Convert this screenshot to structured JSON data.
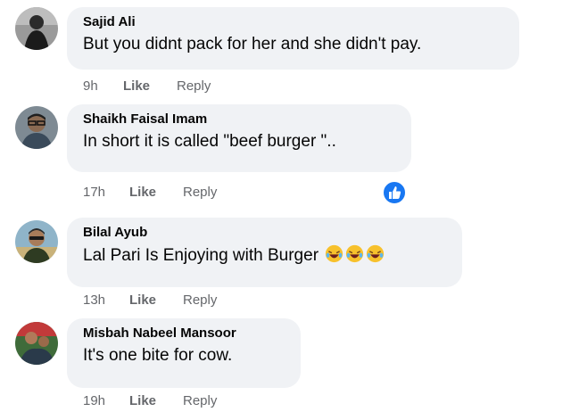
{
  "comments": [
    {
      "author": "Sajid Ali",
      "text": "But you didnt pack for her and she didn't pay.",
      "time": "9h",
      "like": "Like",
      "reply": "Reply"
    },
    {
      "author": "Shaikh Faisal Imam",
      "text": "In short it is called \"beef burger \"..",
      "time": "17h",
      "like": "Like",
      "reply": "Reply",
      "reaction": "like-reaction-icon"
    },
    {
      "author": "Bilal Ayub",
      "text": "Lal Pari Is Enjoying with Burger",
      "emojis": [
        "rolling-on-floor-laughing-icon",
        "rolling-on-floor-laughing-icon",
        "rolling-on-floor-laughing-icon"
      ],
      "time": "13h",
      "like": "Like",
      "reply": "Reply"
    },
    {
      "author": "Misbah Nabeel Mansoor",
      "text": "It's one bite for cow.",
      "time": "19h",
      "like": "Like",
      "reply": "Reply"
    }
  ],
  "colors": {
    "bubble": "#f0f2f5",
    "meta": "#65676b",
    "text": "#050505",
    "like_blue": "#1877f2"
  }
}
